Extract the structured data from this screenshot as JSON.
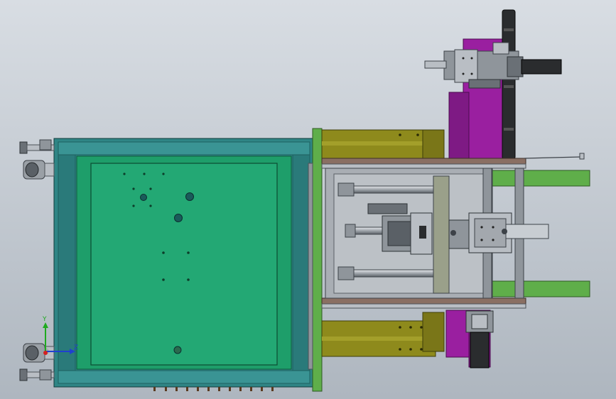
{
  "viewport": {
    "background_top": "#d8dde3",
    "background_bottom": "#aeb6bf"
  },
  "colors": {
    "frame_teal": "#2f8585",
    "frame_teal_dark": "#1d5f5f",
    "panel_green": "#1e9e6a",
    "panel_green_dark": "#137a4f",
    "olive": "#8e8a1c",
    "olive_dark": "#5f5c10",
    "purple": "#9a1fa0",
    "purple_dark": "#6d1472",
    "light_green": "#5fae4a",
    "steel": "#8f959b",
    "steel_light": "#b9bec4",
    "steel_dark": "#4d5358",
    "black_part": "#2a2c2e",
    "rail_brown": "#8a6f63"
  },
  "triad": {
    "x_label": "X",
    "y_label": "Y",
    "z_label": "Z",
    "x_color": "#d42020",
    "y_color": "#1faa1f",
    "z_color": "#2040d0"
  }
}
